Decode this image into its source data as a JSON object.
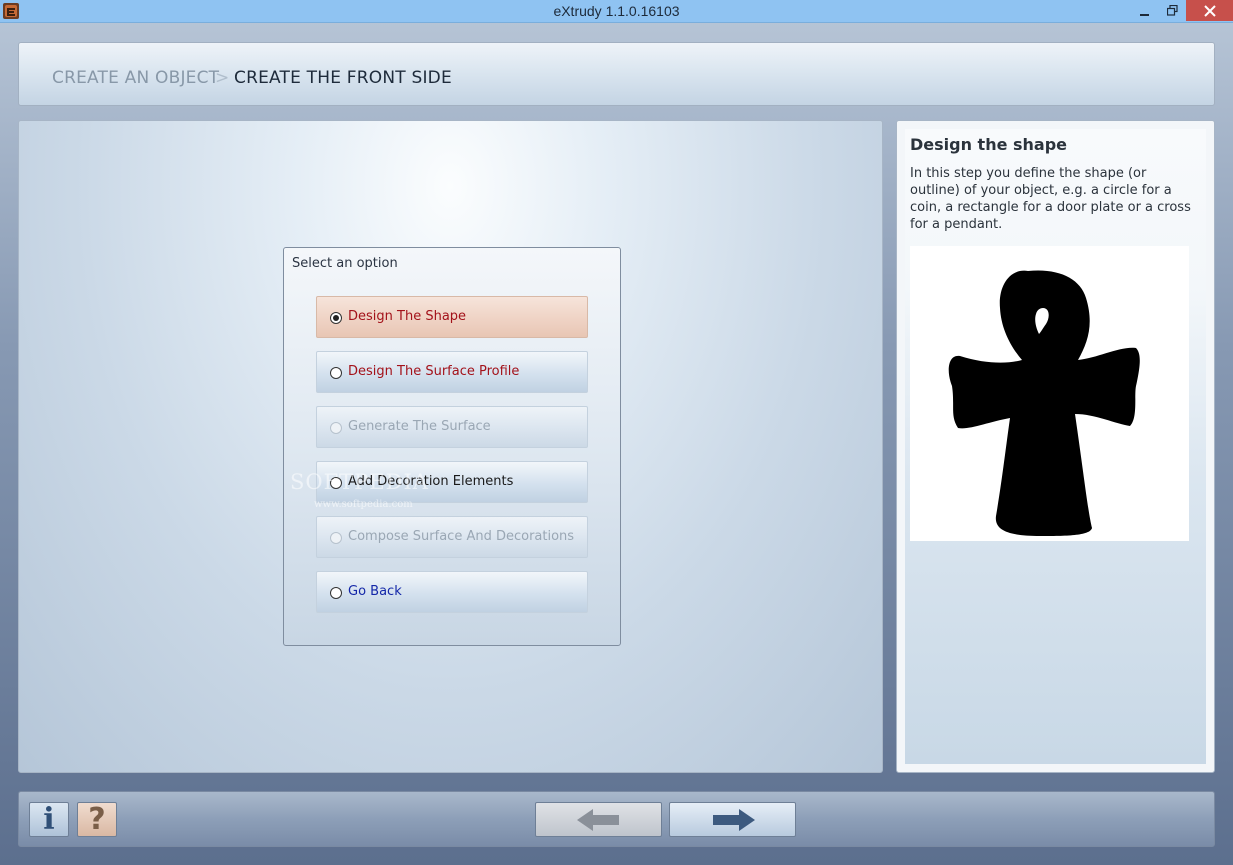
{
  "window": {
    "title": "eXtrudy 1.1.0.16103",
    "icons": {
      "app": "app-icon",
      "minimize": "minimize-icon",
      "restore": "restore-icon",
      "close": "close-icon"
    }
  },
  "breadcrumb": {
    "step1": "CREATE AN OBJECT",
    "separator": ">",
    "step2": "CREATE THE FRONT SIDE"
  },
  "options": {
    "title": "Select an option",
    "items": [
      {
        "label": "Design The Shape",
        "state": "selected"
      },
      {
        "label": "Design The Surface Profile",
        "state": "enabled"
      },
      {
        "label": "Generate The Surface",
        "state": "disabled"
      },
      {
        "label": "Add Decoration Elements",
        "state": "enabled"
      },
      {
        "label": "Compose Surface And Decorations",
        "state": "disabled"
      },
      {
        "label": "Go Back",
        "state": "enabled"
      }
    ]
  },
  "side": {
    "title": "Design the shape",
    "description": "In this step you define the shape (or outline) of your object, e.g. a circle for a coin, a rectangle for a door plate or a cross for a pendant.",
    "preview_icon": "ankh-shape-icon"
  },
  "bottom": {
    "info_label": "i",
    "help_label": "?",
    "back_icon": "arrow-left-icon",
    "next_icon": "arrow-right-icon"
  },
  "watermark": {
    "text": "SOFTPEDIA",
    "sub": "www.softpedia.com"
  },
  "colors": {
    "titlebar": "#8fc3f2",
    "close": "#c7504b",
    "selected_label": "#a3121a",
    "link_label": "#1427a8"
  }
}
